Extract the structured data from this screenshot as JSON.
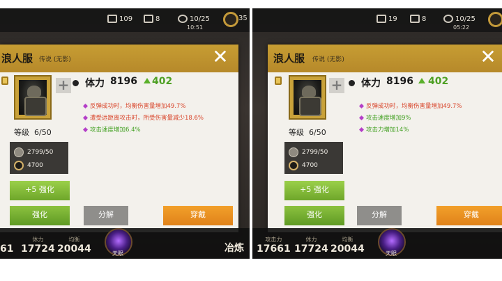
{
  "panels": [
    {
      "resources": {
        "r1": "109",
        "r2": "8",
        "r3": "10/25",
        "timer": "10:51",
        "r4": "35"
      },
      "item": {
        "name": "浪人服",
        "quality": "传说 (无影)",
        "level_label": "等级",
        "level_value": "6/50",
        "stamina_label": "体力",
        "stamina_value": "8196",
        "stamina_bonus": "402",
        "attributes": [
          {
            "text": "反弹成功时，均衡伤害量增加49.7%",
            "color": "red"
          },
          {
            "text": "遭受远距离攻击时，所受伤害量减少18.6%",
            "color": "red"
          },
          {
            "text": "攻击速度增加6.4%",
            "color": "green"
          }
        ],
        "cost_stone": "2799/50",
        "cost_coin": "4700"
      },
      "buttons": {
        "plus5": "+5 强化",
        "upgrade": "强化",
        "decompose": "分解",
        "equip": "穿戴"
      },
      "stats": {
        "s1_label": "",
        "s1_value": "61",
        "s2_label": "体力",
        "s2_value": "17724",
        "s3_label": "均衡",
        "s3_value": "20044",
        "orb_label": "天眼",
        "side_text": "冶炼"
      }
    },
    {
      "resources": {
        "r1": "19",
        "r2": "8",
        "r3": "10/25",
        "timer": "05:22",
        "r4": ""
      },
      "item": {
        "name": "浪人服",
        "quality": "传说 (无影)",
        "level_label": "等级",
        "level_value": "6/50",
        "stamina_label": "体力",
        "stamina_value": "8196",
        "stamina_bonus": "402",
        "attributes": [
          {
            "text": "反弹成功时，均衡伤害量增加49.7%",
            "color": "red"
          },
          {
            "text": "攻击速度增加9%",
            "color": "green"
          },
          {
            "text": "攻击力增加14%",
            "color": "green"
          }
        ],
        "cost_stone": "2799/50",
        "cost_coin": "4700"
      },
      "buttons": {
        "plus5": "+5 强化",
        "upgrade": "强化",
        "decompose": "分解",
        "equip": "穿戴"
      },
      "stats": {
        "s1_label": "攻击力",
        "s1_value": "17661",
        "s2_label": "体力",
        "s2_value": "17724",
        "s3_label": "均衡",
        "s3_value": "20044",
        "orb_label": "天眼",
        "side_text": ""
      }
    }
  ],
  "colors": {
    "header_gold": "#c79d33",
    "upgrade_green": "#8cc23f",
    "equip_orange": "#f2a02a",
    "bonus_green": "#4ea024",
    "attr_red": "#d9462c"
  }
}
